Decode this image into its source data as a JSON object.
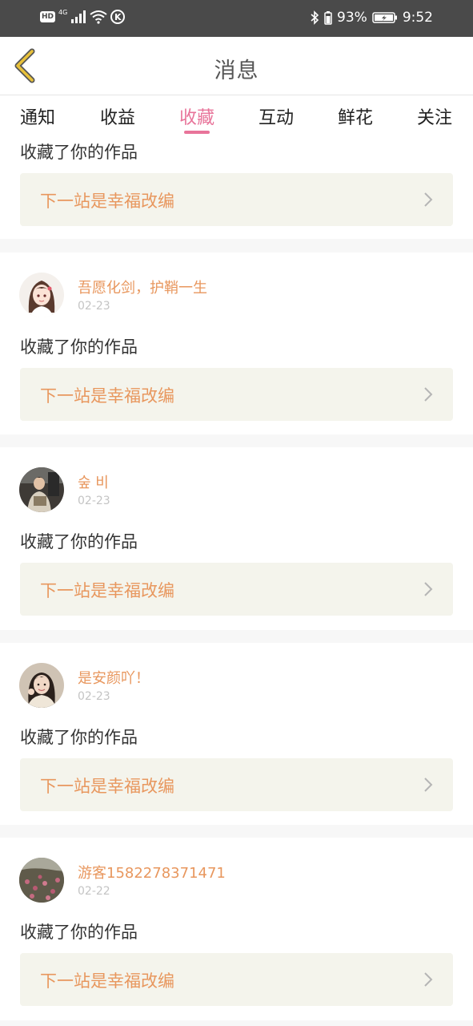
{
  "status_bar": {
    "hd": "HD",
    "network": "4G",
    "k_badge": "K",
    "battery": "93%",
    "time": "9:52"
  },
  "header": {
    "title": "消息"
  },
  "tabs": [
    {
      "label": "通知"
    },
    {
      "label": "收益"
    },
    {
      "label": "收藏",
      "active": true
    },
    {
      "label": "互动"
    },
    {
      "label": "鲜花"
    },
    {
      "label": "关注"
    }
  ],
  "colors": {
    "accent": "#e8749a",
    "username": "#e8975e",
    "back_icon": "#e8c13a",
    "work_box": "#f4f4ec"
  },
  "partial_card": {
    "action": "收藏了你的作品",
    "work_title": "下一站是幸福改编"
  },
  "messages": [
    {
      "user": "吾愿化剑，护鞘一生",
      "date": "02-23",
      "action": "收藏了你的作品",
      "work_title": "下一站是幸福改编",
      "avatar_icon": "anime-girl-avatar"
    },
    {
      "user": "숲 비",
      "date": "02-23",
      "action": "收藏了你的作品",
      "work_title": "下一站是幸福改编",
      "avatar_icon": "photo-avatar-street"
    },
    {
      "user": "是安颜吖！",
      "date": "02-23",
      "action": "收藏了你的作品",
      "work_title": "下一站是幸福改编",
      "avatar_icon": "photo-avatar-girl"
    },
    {
      "user": "游客1582278371471",
      "date": "02-22",
      "action": "收藏了你的作品",
      "work_title": "下一站是幸福改编",
      "avatar_icon": "photo-avatar-flowers"
    }
  ]
}
